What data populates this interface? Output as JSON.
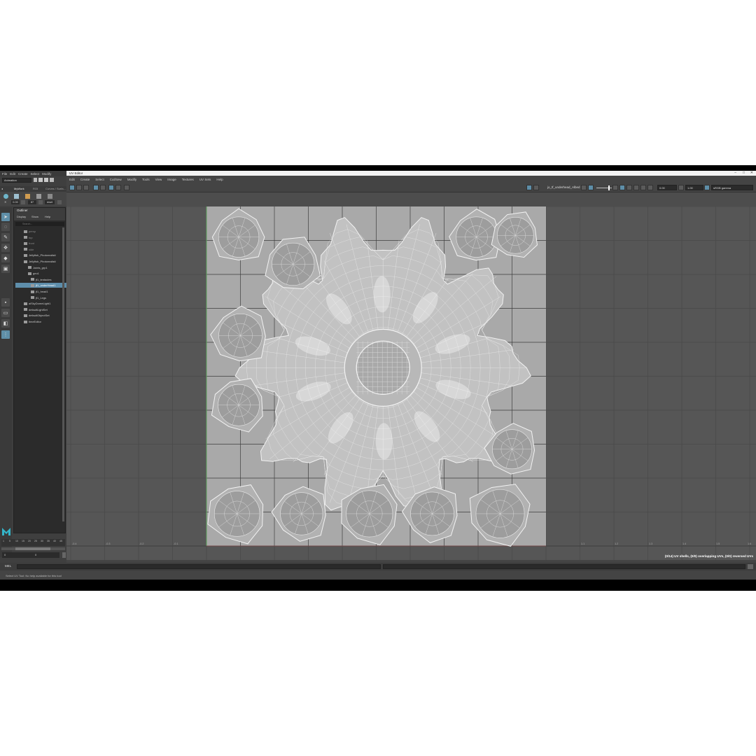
{
  "maya_menu": [
    "File",
    "Edit",
    "Create",
    "Select",
    "Modify"
  ],
  "workspace": {
    "mode": "Animation",
    "shelf_tab": "MyWork",
    "shelf_tab2": "ROI",
    "shelf_tab3": "Curves / Surfa..."
  },
  "uv_editor": {
    "title": "UV Editor",
    "menu": [
      "Edit",
      "Create",
      "Select",
      "Cut/Sew",
      "Modify",
      "Tools",
      "View",
      "Image",
      "Textures",
      "UV Sets",
      "Help"
    ],
    "texture_name": "jo_tf_underhead_Albed",
    "exposure": "0.00",
    "gamma": "1.00",
    "color_space": "sRGB gamma",
    "status": "(0/14) UV shells, (0/0) overlapping UVs, (0/0) reversed UVs"
  },
  "axis_ticks_left": [
    "-0.4",
    "-0.3",
    "-0.2",
    "-0.1"
  ],
  "axis_ticks_right": [
    "1.1",
    "1.2",
    "1.3",
    "1.4",
    "1.5",
    "1.6"
  ],
  "outliner": {
    "title": "Outliner",
    "menu": [
      "Display",
      "Show",
      "Help"
    ],
    "search_placeholder": "Search...",
    "items": [
      {
        "label": "persp",
        "state": "grey"
      },
      {
        "label": "top",
        "state": "grey"
      },
      {
        "label": "front",
        "state": "grey"
      },
      {
        "label": "side",
        "state": "grey"
      },
      {
        "label": "Jellyfish_Photorealisti",
        "state": "normal"
      },
      {
        "label": "Jellyfish_Photorealisti",
        "state": "normal"
      },
      {
        "label": "Joints_grp1",
        "state": "normal"
      },
      {
        "label": "geo1",
        "state": "normal"
      },
      {
        "label": "jf1_tentacles",
        "state": "normal"
      },
      {
        "label": "jf1_underHead1",
        "state": "selected"
      },
      {
        "label": "jf1_head1",
        "state": "normal"
      },
      {
        "label": "jf1_Legs",
        "state": "normal"
      },
      {
        "label": "aiSkyDomeLight1",
        "state": "normal"
      },
      {
        "label": "defaultLightSet",
        "state": "normal"
      },
      {
        "label": "defaultObjectSet",
        "state": "normal"
      },
      {
        "label": "timeEditor",
        "state": "normal"
      }
    ]
  },
  "timeslider": {
    "ticks": [
      "1",
      "5",
      "10",
      "15",
      "20",
      "25",
      "30",
      "35",
      "40",
      "45"
    ],
    "start": "0",
    "end": "0"
  },
  "shelf_values": [
    "0.00",
    "87",
    "reset"
  ],
  "command_line": {
    "label": "MEL"
  },
  "help_line": "Select UV Tool: No help available for this tool",
  "colors": {
    "accent": "#5e8eab",
    "uv_space": "#a9a9a9",
    "grid": "#3e3e3e",
    "wire": "#f2f2f2"
  }
}
